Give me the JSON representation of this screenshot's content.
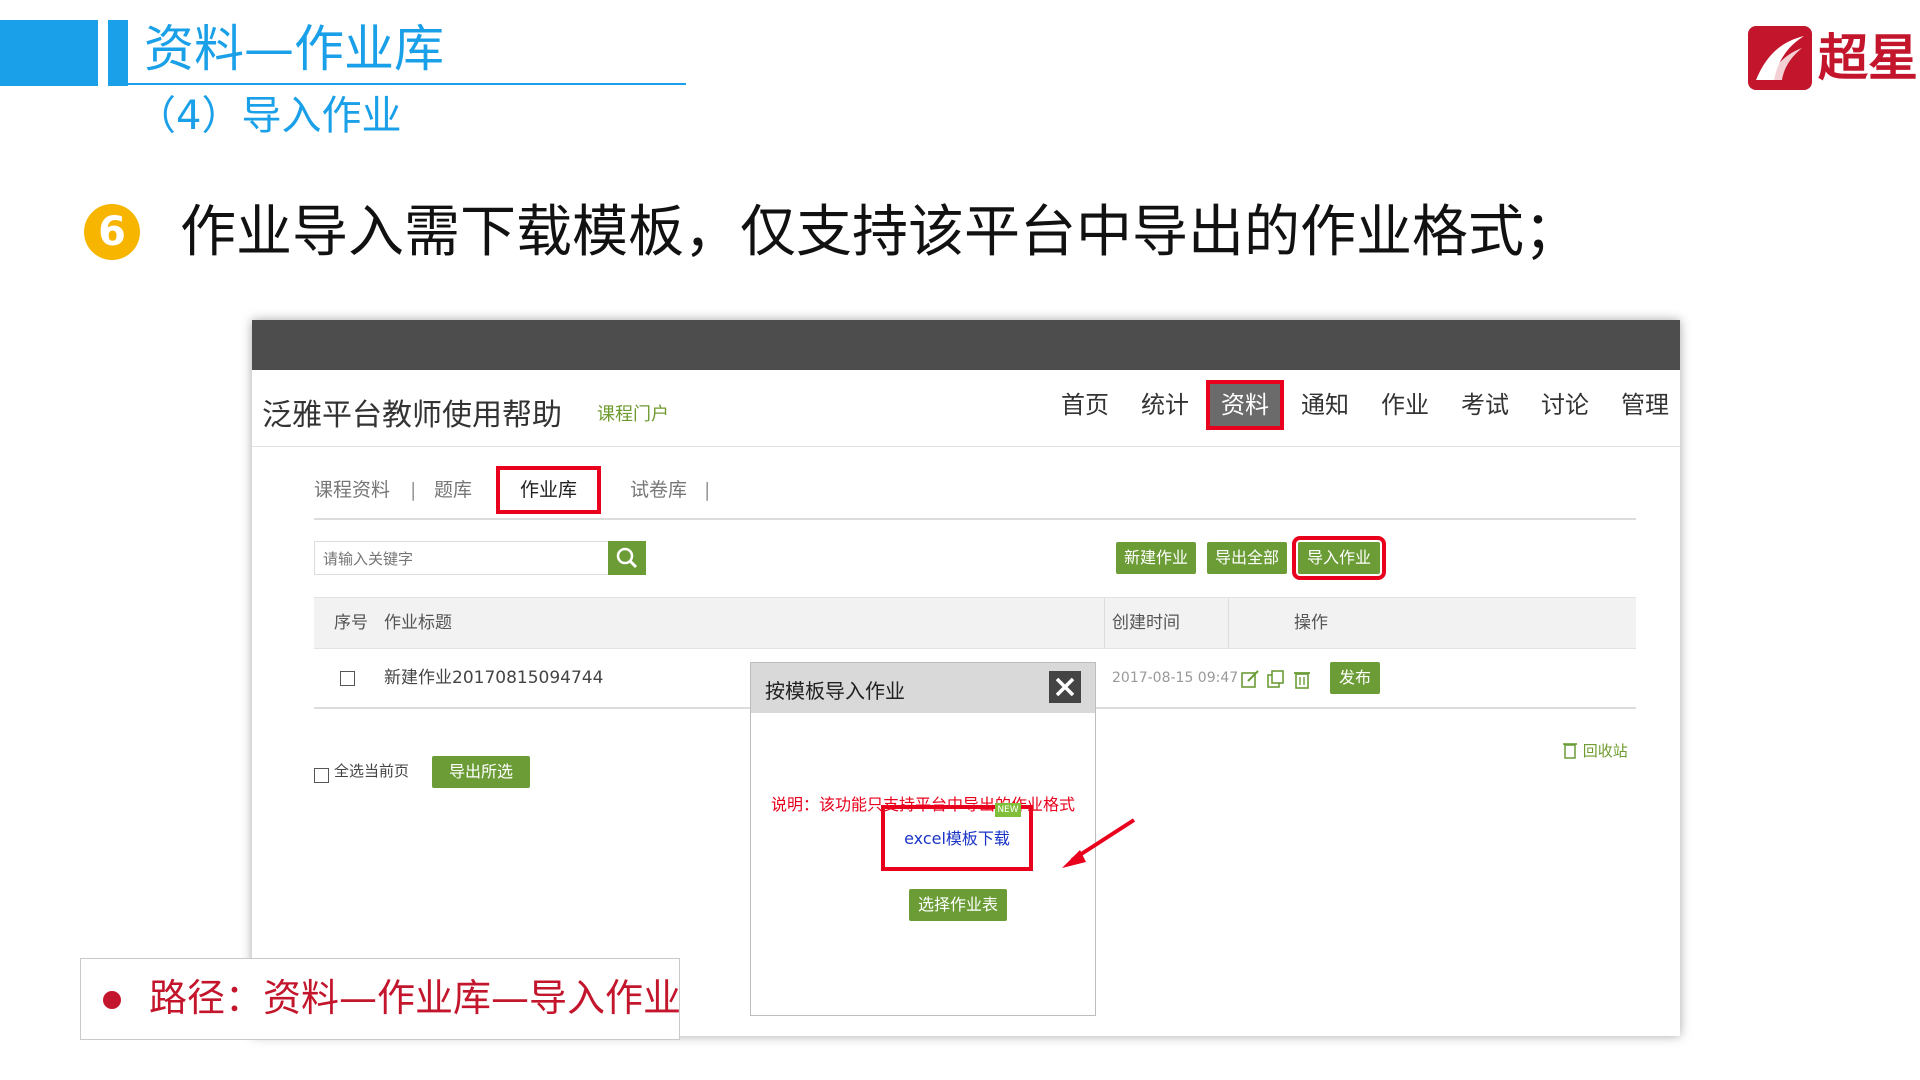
{
  "slide": {
    "title": "资料—作业库",
    "subtitle": "（4）导入作业",
    "logo_text": "超星",
    "point_number": "6",
    "point_text": "作业导入需下载模板，仅支持该平台中导出的作业格式；",
    "path_note": "路径：资料—作业库—导入作业"
  },
  "site": {
    "title": "泛雅平台教师使用帮助",
    "portal_link": "课程门户",
    "nav": [
      "首页",
      "统计",
      "资料",
      "通知",
      "作业",
      "考试",
      "讨论",
      "管理"
    ],
    "nav_active": "资料"
  },
  "subtabs": [
    "课程资料",
    "题库",
    "作业库",
    "试卷库"
  ],
  "subtabs_active": "作业库",
  "search": {
    "placeholder": "请输入关键字"
  },
  "toolbar": {
    "new": "新建作业",
    "export_all": "导出全部",
    "import": "导入作业"
  },
  "table": {
    "headers": {
      "index": "序号",
      "title": "作业标题",
      "created": "创建时间",
      "ops": "操作"
    },
    "rows": [
      {
        "title": "新建作业20170815094744",
        "created": "2017-08-15 09:47",
        "publish": "发布"
      }
    ]
  },
  "footer": {
    "select_all": "全选当前页",
    "export_selected": "导出所选",
    "recycle": "回收站"
  },
  "modal": {
    "title": "按模板导入作业",
    "note": "说明：该功能只支持平台中导出的作业格式",
    "download_link": "excel模板下载",
    "new_badge": "NEW",
    "choose_button": "选择作业表"
  },
  "colors": {
    "accent_blue": "#1aa0e8",
    "brand_red": "#c3162c",
    "button_green": "#6b9c36",
    "highlight_red": "#e8001c"
  }
}
